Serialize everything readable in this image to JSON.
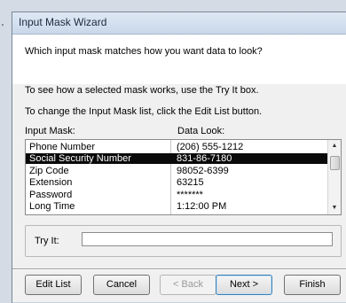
{
  "window": {
    "title": "Input Mask Wizard"
  },
  "edge_mark": "'",
  "header": {
    "question": "Which input mask matches how you want data to look?"
  },
  "instructions": {
    "try_it": "To see how a selected mask works, use the Try It box.",
    "edit_list": "To change the Input Mask list, click the Edit List button."
  },
  "columns": {
    "mask": "Input Mask:",
    "look": "Data Look:"
  },
  "masks": [
    {
      "name": "Phone Number",
      "look": "(206) 555-1212",
      "selected": false
    },
    {
      "name": "Social Security Number",
      "look": "831-86-7180",
      "selected": true
    },
    {
      "name": "Zip Code",
      "look": "98052-6399",
      "selected": false
    },
    {
      "name": "Extension",
      "look": "63215",
      "selected": false
    },
    {
      "name": "Password",
      "look": "*******",
      "selected": false
    },
    {
      "name": "Long Time",
      "look": "1:12:00 PM",
      "selected": false
    }
  ],
  "try_it": {
    "label": "Try It:",
    "value": ""
  },
  "buttons": {
    "edit_list": "Edit List",
    "cancel": "Cancel",
    "back": "< Back",
    "next": "Next >",
    "finish": "Finish"
  }
}
